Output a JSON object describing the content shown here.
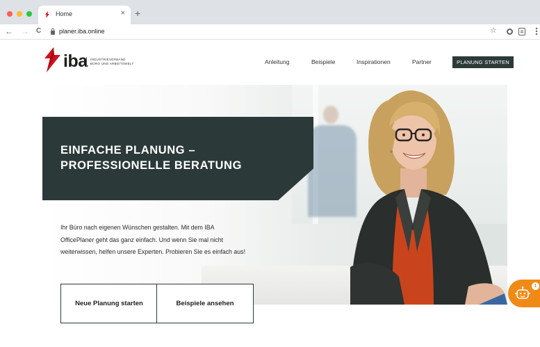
{
  "browser": {
    "tab_title": "Home",
    "tab_close": "×",
    "new_tab": "+",
    "url": "planer.iba.online",
    "back": "←",
    "forward": "→",
    "reload": "C",
    "bookmark": "☆"
  },
  "header": {
    "logo_text": "iba",
    "logo_sub_line1": "INDUSTRIEVERBAND",
    "logo_sub_line2": "BÜRO UND ARBEITSWELT",
    "nav": [
      "Anleitung",
      "Beispiele",
      "Inspirationen",
      "Partner"
    ],
    "cta": "PLANUNG STARTEN"
  },
  "hero": {
    "headline": "EINFACHE PLANUNG – PROFESSIONELLE BERATUNG",
    "intro": "Ihr Büro nach eigenen Wünschen gestalten. Mit dem IBA OfficePlaner geht das ganz einfach. Und wenn Sie mal nicht weiterwissen, helfen unsere Experten. Probieren Sie es einfach aus!",
    "btn_new": "Neue Planung starten",
    "btn_examples": "Beispiele ansehen"
  },
  "chat": {
    "badge": "1"
  },
  "colors": {
    "brand_red": "#d4111b",
    "dark_teal": "#2b3a38",
    "chat_orange": "#f08a16"
  },
  "icons": {
    "tab_favicon": "iba-flame-icon",
    "lock": "lock-icon",
    "chat": "chatbot-icon",
    "extensions": [
      "circle-extension-icon",
      "reader-extension-icon",
      "menu-dots-icon"
    ]
  }
}
